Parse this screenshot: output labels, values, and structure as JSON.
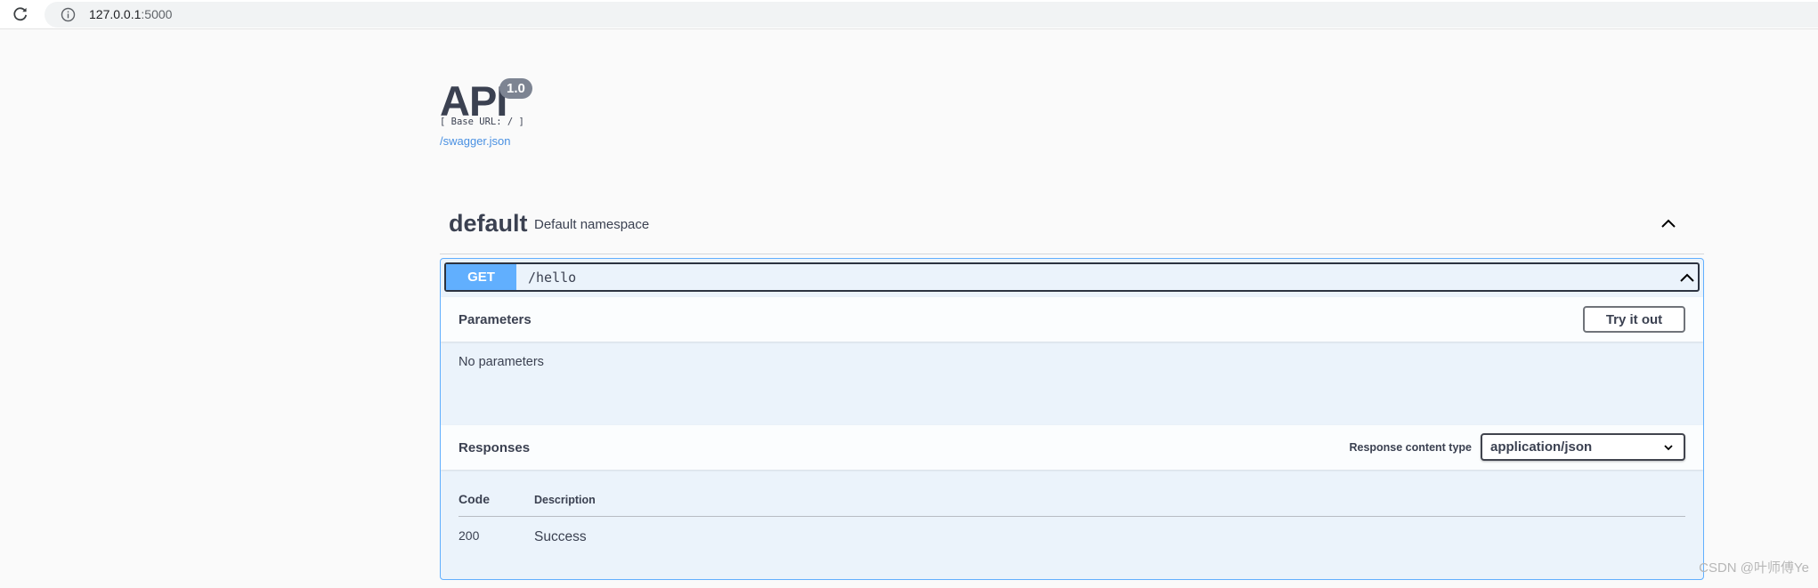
{
  "browser": {
    "url_host": "127.0.0.1",
    "url_port": ":5000",
    "icons": [
      "reload-icon",
      "info-icon"
    ]
  },
  "info": {
    "title": "API",
    "version": "1.0",
    "base_url": "[ Base URL: / ]",
    "spec_link": "/swagger.json"
  },
  "tag": {
    "name": "default",
    "description": "Default namespace",
    "expanded": true
  },
  "operation": {
    "method": "GET",
    "path": "/hello",
    "method_color": "#61afe8"
  },
  "parameters": {
    "title": "Parameters",
    "try_button": "Try it out",
    "empty_text": "No parameters"
  },
  "responses": {
    "title": "Responses",
    "content_type_label": "Response content type",
    "content_type_value": "application/json",
    "columns": [
      "Code",
      "Description"
    ],
    "rows": [
      {
        "code": "200",
        "description": "Success"
      }
    ]
  },
  "watermark": "CSDN @叶师傅Ye"
}
